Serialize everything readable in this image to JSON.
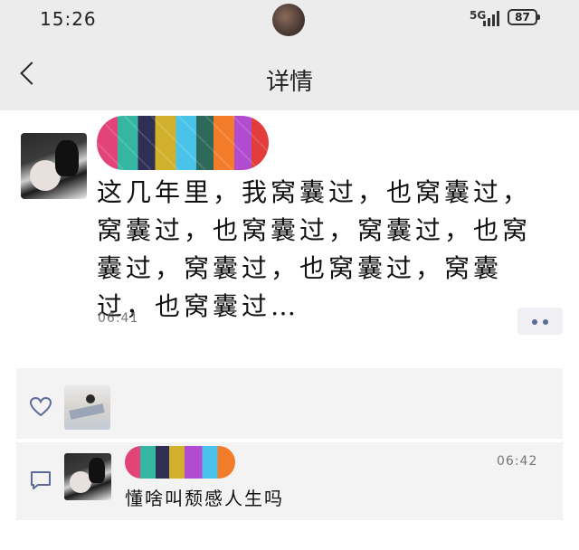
{
  "status_bar": {
    "time": "15:26",
    "network": "5G",
    "battery": "87"
  },
  "header": {
    "title": "详情"
  },
  "post": {
    "text": "这几年里，我窝囊过，也窝囊过，窝囊过，也窝囊过，窝囊过，也窝囊过，窝囊过，也窝囊过，窝囊过，也窝囊过…",
    "time": "06:41"
  },
  "comment": {
    "text": "懂啥叫颓感人生吗",
    "time": "06:42"
  },
  "icons": {
    "back": "chevron-left-icon",
    "more": "more-dots-icon",
    "like": "heart-icon",
    "comment": "comment-icon"
  }
}
